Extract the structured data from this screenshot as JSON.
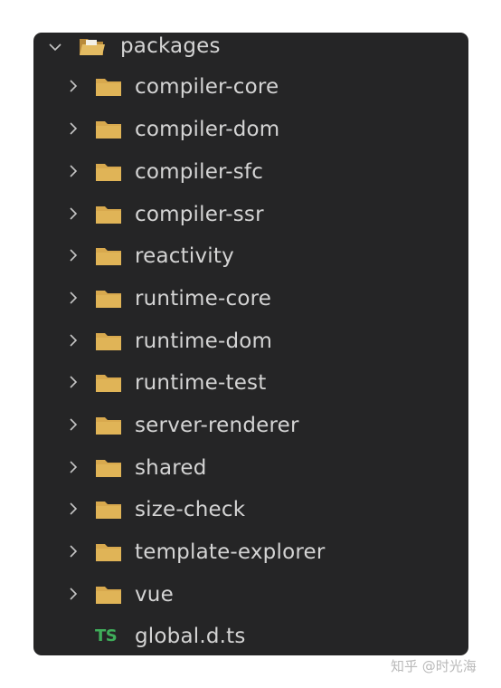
{
  "explorer": {
    "root": {
      "label": "packages",
      "icon": "open-folder-icon",
      "expanded": true
    },
    "folders": [
      {
        "label": "compiler-core"
      },
      {
        "label": "compiler-dom"
      },
      {
        "label": "compiler-sfc"
      },
      {
        "label": "compiler-ssr"
      },
      {
        "label": "reactivity"
      },
      {
        "label": "runtime-core"
      },
      {
        "label": "runtime-dom"
      },
      {
        "label": "runtime-test"
      },
      {
        "label": "server-renderer"
      },
      {
        "label": "shared"
      },
      {
        "label": "size-check"
      },
      {
        "label": "template-explorer"
      },
      {
        "label": "vue"
      }
    ],
    "files": [
      {
        "label": "global.d.ts",
        "icon_text": "TS"
      }
    ]
  },
  "colors": {
    "panel_bg": "#252526",
    "text": "#d4d4d4",
    "folder": "#d8a94e",
    "ts_icon": "#3fae5a"
  },
  "watermark": {
    "text": "知乎 @时光海"
  }
}
